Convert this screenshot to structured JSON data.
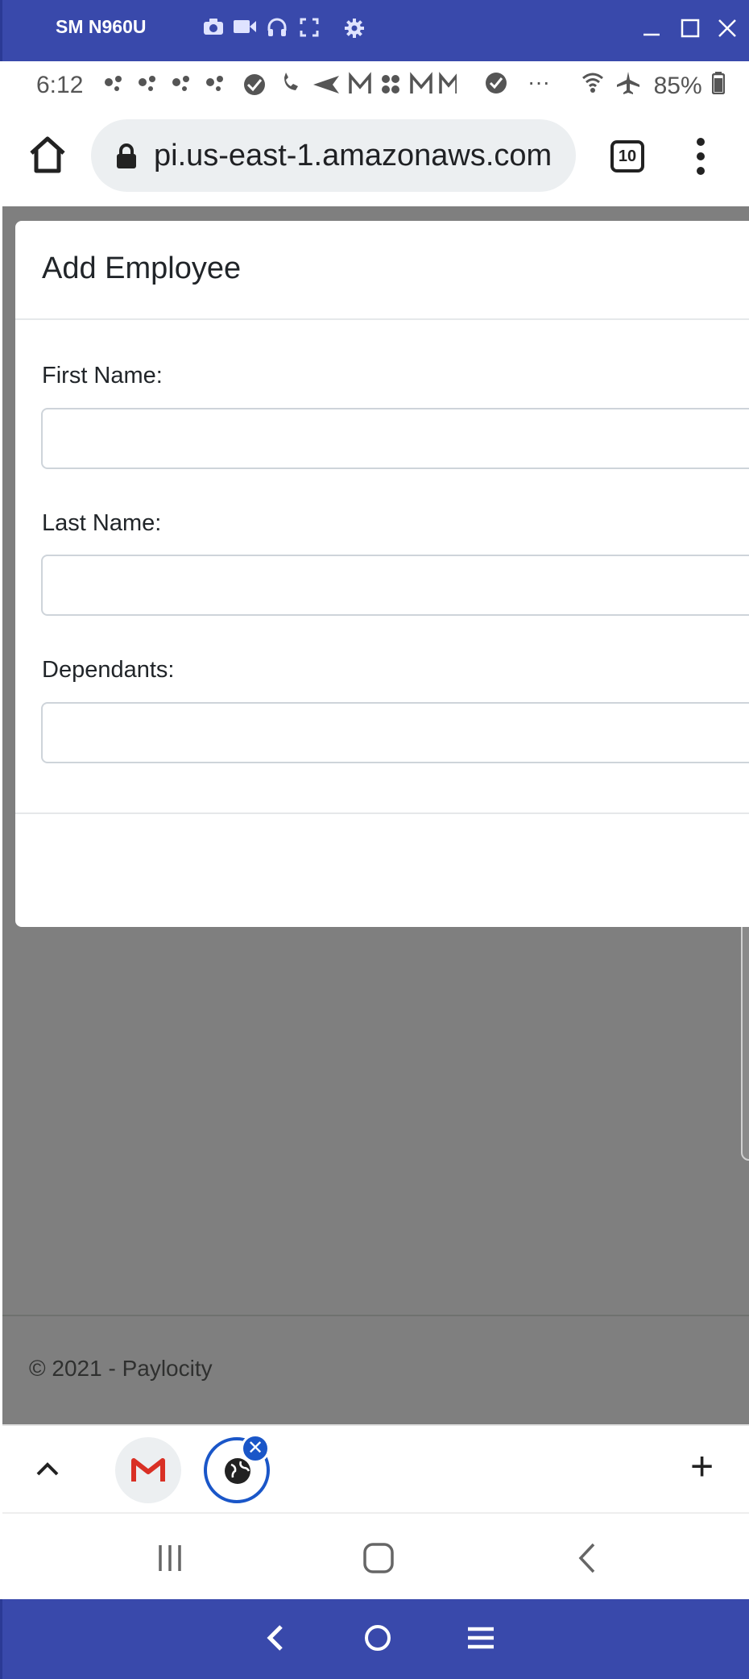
{
  "window": {
    "title": "SM N960U",
    "tool_icons": [
      "camera-icon",
      "video-icon",
      "headphones-icon",
      "fullscreen-icon",
      "settings-icon"
    ],
    "controls": [
      "minimize-icon",
      "maximize-icon",
      "close-icon"
    ],
    "accent_color": "#3949ab"
  },
  "status_bar": {
    "time": "6:12",
    "battery": "85%",
    "overflow": "···"
  },
  "browser": {
    "url": "pi.us-east-1.amazonaws.com",
    "tab_count": "10"
  },
  "modal": {
    "title": "Add Employee",
    "fields": [
      {
        "label": "First Name:",
        "value": ""
      },
      {
        "label": "Last Name:",
        "value": ""
      },
      {
        "label": "Dependants:",
        "value": ""
      }
    ]
  },
  "footer": {
    "text": "© 2021 - Paylocity"
  },
  "bottom_bar": {
    "close_glyph": "✕",
    "add_glyph": "+",
    "highlight_color": "#1a56c8"
  }
}
